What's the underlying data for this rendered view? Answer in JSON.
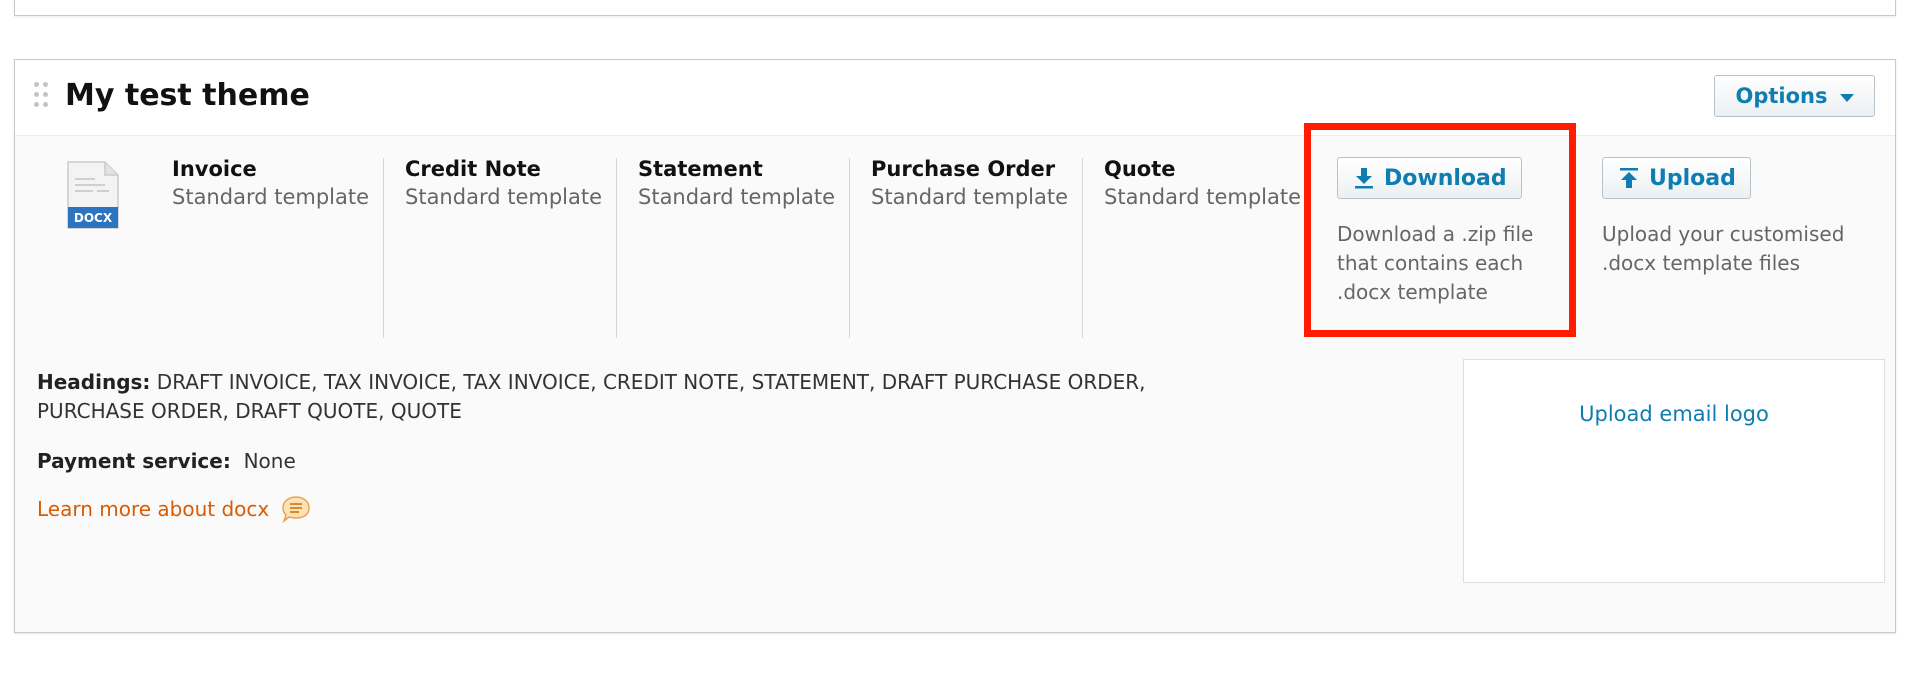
{
  "theme": {
    "title": "My test theme",
    "options_label": "Options"
  },
  "docx_icon": {
    "label": "DOCX"
  },
  "templates": [
    {
      "name": "Invoice",
      "sub": "Standard template"
    },
    {
      "name": "Credit Note",
      "sub": "Standard template"
    },
    {
      "name": "Statement",
      "sub": "Standard template"
    },
    {
      "name": "Purchase Order",
      "sub": "Standard template"
    },
    {
      "name": "Quote",
      "sub": "Standard template"
    }
  ],
  "download": {
    "label": "Download",
    "desc_lines": [
      "Download a .zip file",
      "that contains each",
      ".docx template"
    ]
  },
  "upload": {
    "label": "Upload",
    "desc_lines": [
      "Upload your customised",
      ".docx template files"
    ]
  },
  "headings": {
    "label": "Headings:",
    "line1": "DRAFT INVOICE, TAX INVOICE, TAX INVOICE, CREDIT NOTE, STATEMENT, DRAFT PURCHASE ORDER,",
    "line2": "PURCHASE ORDER, DRAFT QUOTE, QUOTE"
  },
  "payment": {
    "label": "Payment service:",
    "value": "None"
  },
  "learn_more": "Learn more about docx",
  "email_logo": "Upload email logo",
  "colors": {
    "link_blue": "#0f7db1",
    "link_orange": "#d85c04",
    "highlight_red": "#ff1c00"
  }
}
